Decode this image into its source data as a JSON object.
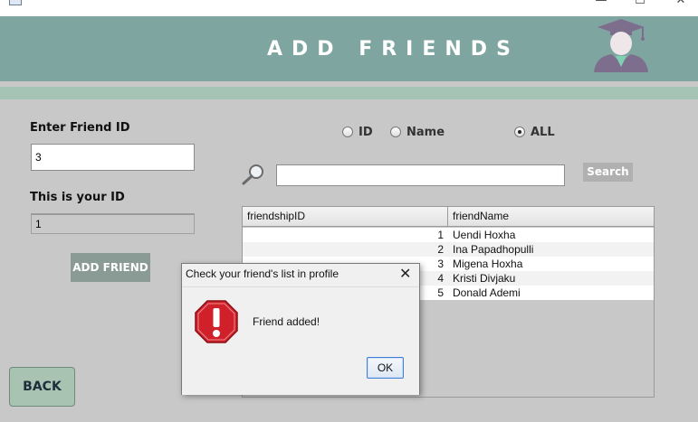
{
  "window": {
    "minimize_glyph": "—",
    "maximize_glyph": "☐",
    "close_glyph": "✕"
  },
  "header": {
    "title": "ADD FRIENDS",
    "avatar_icon": "graduate-avatar-icon"
  },
  "left_panel": {
    "friend_id_label": "Enter Friend ID",
    "friend_id_value": "3",
    "your_id_label": "This is your ID",
    "your_id_value": "1",
    "add_button": "ADD FRIEND",
    "back_button": "BACK"
  },
  "filters": {
    "options": [
      {
        "label": "ID",
        "selected": false
      },
      {
        "label": "Name",
        "selected": false
      },
      {
        "label": "ALL",
        "selected": true
      }
    ]
  },
  "search": {
    "value": "",
    "button": "Search",
    "icon": "magnifier-icon"
  },
  "table": {
    "columns": [
      "friendshipID",
      "friendName"
    ],
    "rows": [
      {
        "id": "1",
        "name": "Uendi Hoxha"
      },
      {
        "id": "2",
        "name": "Ina Papadhopulli"
      },
      {
        "id": "3",
        "name": "Migena Hoxha"
      },
      {
        "id": "4",
        "name": "Kristi Divjaku"
      },
      {
        "id": "5",
        "name": "Donald Ademi"
      }
    ]
  },
  "dialog": {
    "title": "Check your friend's list in profile",
    "message": "Friend added!",
    "ok": "OK",
    "close_glyph": "✕",
    "icon": "warning-icon"
  },
  "colors": {
    "header": "#7fa5a1",
    "band": "#a6c4b5",
    "background": "#c8c8c8",
    "add_button": "#8a9a94",
    "back_button": "#a8c3b1",
    "search_button": "#b0b0b0",
    "warning_red": "#d0202a"
  }
}
